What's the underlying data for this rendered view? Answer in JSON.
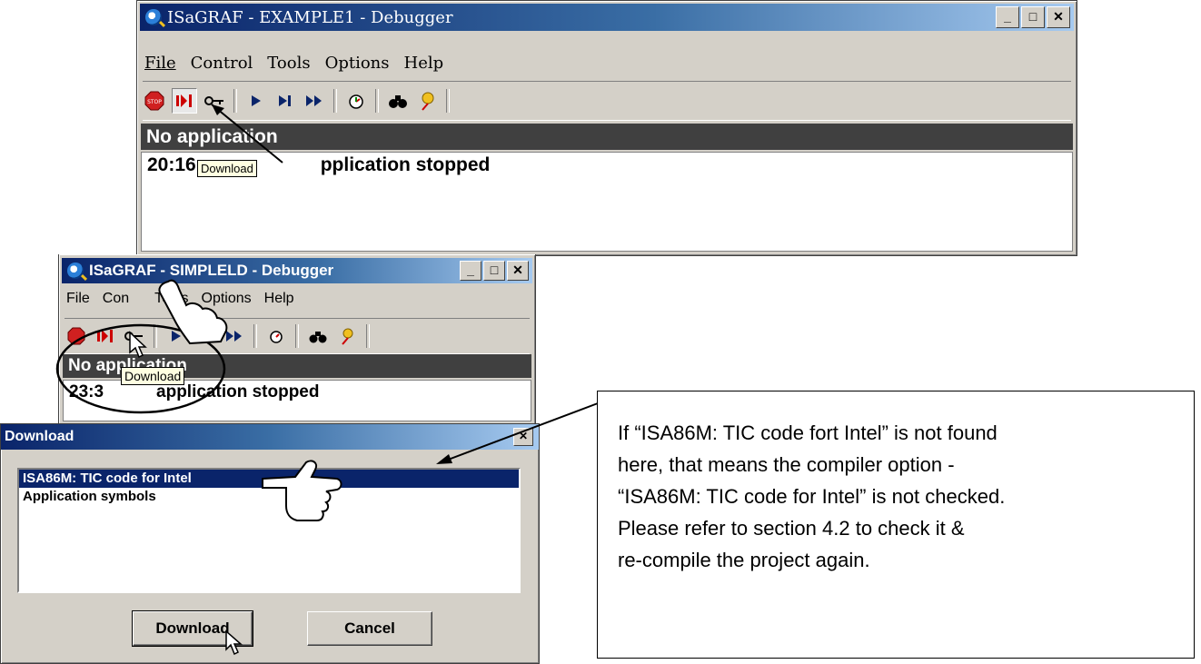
{
  "win1": {
    "title": "ISaGRAF - EXAMPLE1 - Debugger",
    "menu": [
      "File",
      "Control",
      "Tools",
      "Options",
      "Help"
    ],
    "status": "No application",
    "log_time": "20:16",
    "log_text": "pplication stopped",
    "tooltip": "Download"
  },
  "win2": {
    "title": "ISaGRAF - SIMPLELD - Debugger",
    "menu": [
      "File",
      "Con",
      "Tools",
      "Options",
      "Help"
    ],
    "status": "No application",
    "log_prefix": "23:3",
    "log_text": "application stopped",
    "tooltip": "Download"
  },
  "dialog": {
    "title": "Download",
    "items": [
      "ISA86M: TIC code for Intel",
      "Application symbols"
    ],
    "download_label": "Download",
    "cancel_label": "Cancel"
  },
  "note": {
    "lines": [
      "If “ISA86M: TIC code fort Intel” is not found",
      "here, that means the compiler option -",
      "“ISA86M: TIC code for Intel” is not checked.",
      "Please refer to section 4.2 to check it &",
      "re-compile the project again."
    ]
  },
  "window_buttons": {
    "minimize": "_",
    "maximize": "□",
    "close": "✕"
  }
}
